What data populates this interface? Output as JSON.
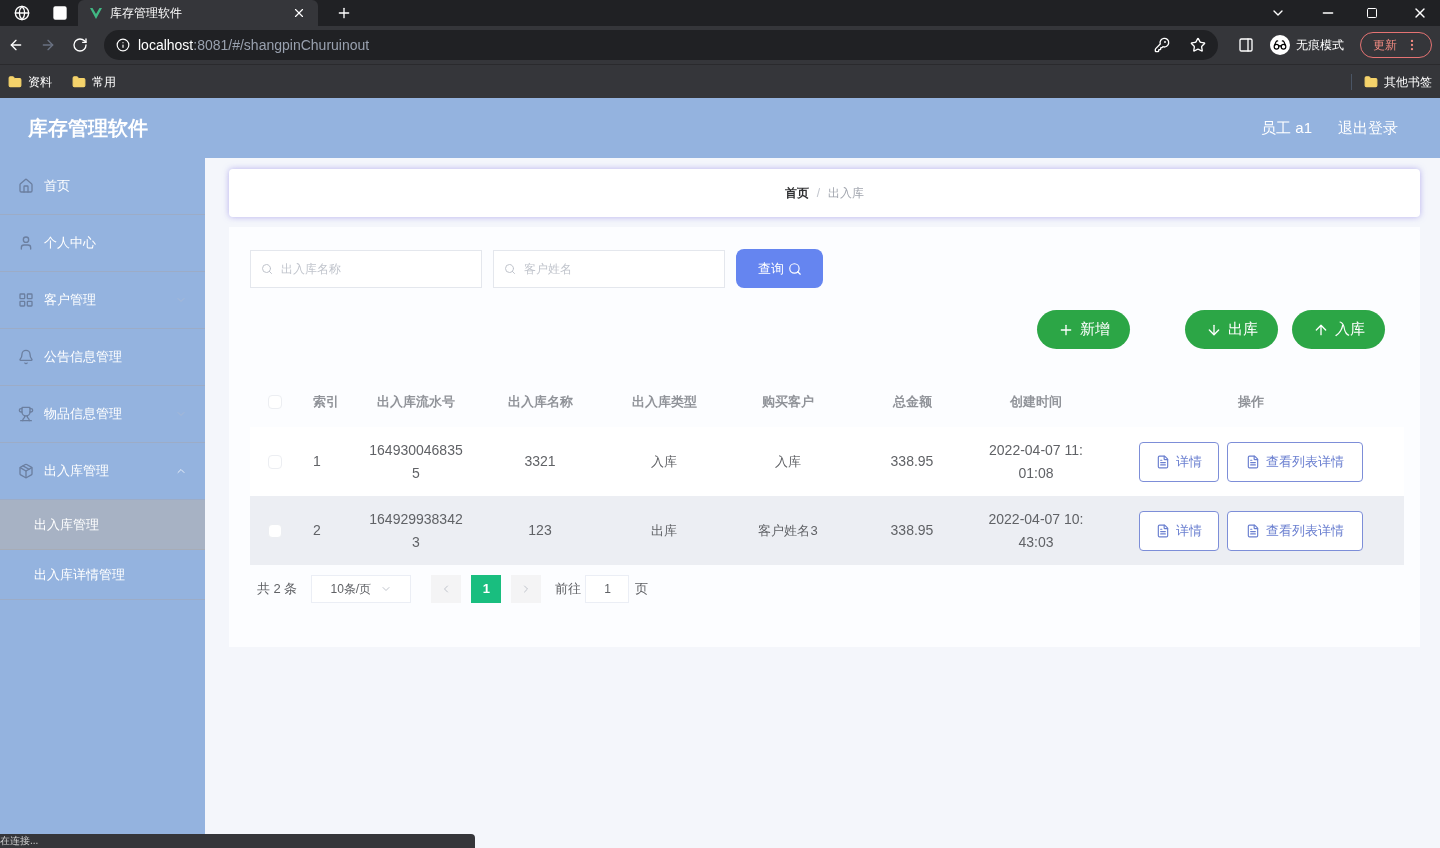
{
  "browser": {
    "tab_title": "库存管理软件",
    "url_host": "localhost",
    "url_rest": ":8081/#/shangpinChuruinout",
    "incognito_label": "无痕模式",
    "update_label": "更新",
    "bookmarks": [
      "资料",
      "常用"
    ],
    "other_bookmarks": "其他书签"
  },
  "header": {
    "title": "库存管理软件",
    "user": "员工 a1",
    "logout": "退出登录"
  },
  "sidebar": {
    "items": [
      {
        "label": "首页",
        "kind": "link"
      },
      {
        "label": "个人中心",
        "kind": "link"
      },
      {
        "label": "客户管理",
        "kind": "submenu",
        "expanded": false
      },
      {
        "label": "公告信息管理",
        "kind": "link"
      },
      {
        "label": "物品信息管理",
        "kind": "submenu",
        "expanded": false
      },
      {
        "label": "出入库管理",
        "kind": "submenu",
        "expanded": true,
        "children": [
          {
            "label": "出入库管理",
            "selected": true
          },
          {
            "label": "出入库详情管理",
            "selected": false
          }
        ]
      }
    ]
  },
  "breadcrumb": [
    "首页",
    "出入库"
  ],
  "breadcrumb_separator": "/",
  "search": {
    "fields": [
      {
        "placeholder": "出入库名称"
      },
      {
        "placeholder": "客户姓名"
      }
    ],
    "button": "查询"
  },
  "actions": [
    {
      "label": "新增",
      "kind": "add"
    },
    {
      "label": "出库",
      "kind": "out"
    },
    {
      "label": "入库",
      "kind": "in"
    }
  ],
  "table": {
    "select_all_checked": false,
    "columns": [
      "索引",
      "出入库流水号",
      "出入库名称",
      "出入库类型",
      "购买客户",
      "总金额",
      "创建时间",
      "操作"
    ],
    "rows": [
      {
        "checked": false,
        "selected": false,
        "cells": [
          "1",
          "1649300468355",
          "3321",
          "入库",
          "入库",
          "338.95",
          "2022-04-07 11:01:08"
        ],
        "buttons": [
          "详情",
          "查看列表详情"
        ]
      },
      {
        "checked": false,
        "selected": true,
        "cells": [
          "2",
          "1649299383423",
          "123",
          "出库",
          "客户姓名3",
          "338.95",
          "2022-04-07 10:43:03"
        ],
        "buttons": [
          "详情",
          "查看列表详情"
        ]
      }
    ]
  },
  "pagination": {
    "total": "共 2 条",
    "page_size": "10条/页",
    "pages": [
      {
        "label": "1",
        "selected": true
      }
    ],
    "goto_label": "前往",
    "goto_value": "1",
    "goto_suffix": "页"
  },
  "status_bar": "在连接..."
}
